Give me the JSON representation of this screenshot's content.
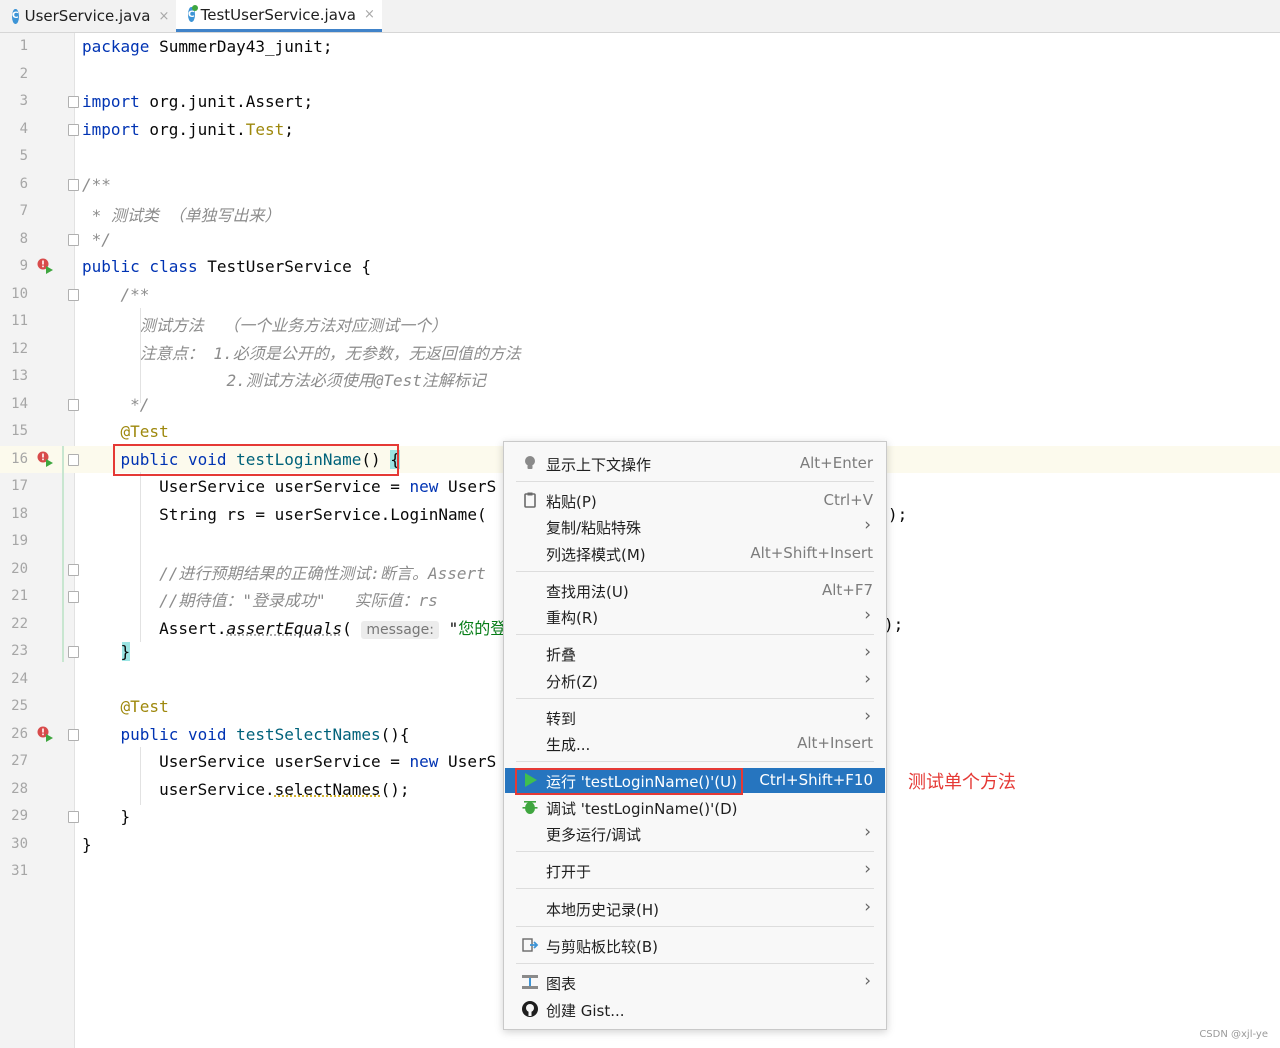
{
  "tabs": [
    {
      "label": "UserService.java",
      "icon": "java-class-icon",
      "close": "×"
    },
    {
      "label": "TestUserService.java",
      "icon": "java-test-class-icon",
      "close": "×"
    }
  ],
  "lines": [
    "1",
    "2",
    "3",
    "4",
    "5",
    "6",
    "7",
    "8",
    "9",
    "10",
    "11",
    "12",
    "13",
    "14",
    "15",
    "16",
    "17",
    "18",
    "19",
    "20",
    "21",
    "22",
    "23",
    "24",
    "25",
    "26",
    "27",
    "28",
    "29",
    "30",
    "31"
  ],
  "code": {
    "l1_kw": "package",
    "l1_rest": " SummerDay43_junit;",
    "l3_kw": "import",
    "l3_rest": " org.junit.Assert;",
    "l4_kw": "import",
    "l4_mid": " org.junit.",
    "l4_test": "Test",
    "l4_end": ";",
    "l6": "/**",
    "l7": " * 测试类 （单独写出来）",
    "l8": " */",
    "l9_kw": "public class",
    "l9_rest": " TestUserService {",
    "l10": "    /**",
    "l11": "      测试方法  （一个业务方法对应测试一个）",
    "l12": "      注意点： 1.必须是公开的，无参数，无返回值的方法",
    "l13": "               2.测试方法必须使用@Test注解标记",
    "l14": "     */",
    "l15": "    @Test",
    "l16_indent": "    ",
    "l16_kw": "public void",
    "l16_fn": " testLoginName",
    "l16_paren": "()",
    "l16_sp": " ",
    "l16_brace": "{",
    "l17_a": "        UserService userService = ",
    "l17_kw": "new",
    "l17_b": " UserS",
    "l17_tail": "",
    "l18_a": "        String rs = userService.LoginName(",
    "l18_tail": ");",
    "l20": "        //进行预期结果的正确性测试:断言。Assert",
    "l21": "        //期待值：\"登录成功\"   实际值：rs",
    "l22_a": "        Assert.",
    "l22_fn": "assertEquals",
    "l22_b": "( ",
    "l22_hint": "message:",
    "l22_c": " \"",
    "l22_str": "您的登",
    "l22_tail": ");",
    "l23": "    }",
    "l25": "    @Test",
    "l26_indent": "    ",
    "l26_kw": "public void",
    "l26_fn": " testSelectNames",
    "l26_rest": "(){",
    "l27_a": "        UserService userService = ",
    "l27_kw": "new",
    "l27_b": " UserS",
    "l28_a": "        userService.",
    "l28_fn": "selectNames",
    "l28_b": "();",
    "l29": "    }",
    "l30": "}"
  },
  "menu": {
    "items": [
      {
        "label": "显示上下文操作",
        "shortcut": "Alt+Enter",
        "icon": "lightbulb-icon"
      },
      {
        "label": "粘贴(P)",
        "shortcut": "Ctrl+V",
        "icon": "clipboard-icon"
      },
      {
        "label": "复制/粘贴特殊",
        "arrow": "›"
      },
      {
        "label": "列选择模式(M)",
        "shortcut": "Alt+Shift+Insert"
      },
      {
        "label": "查找用法(U)",
        "shortcut": "Alt+F7"
      },
      {
        "label": "重构(R)",
        "arrow": "›"
      },
      {
        "label": "折叠",
        "arrow": "›"
      },
      {
        "label": "分析(Z)",
        "arrow": "›"
      },
      {
        "label": "转到",
        "arrow": "›"
      },
      {
        "label": "生成...",
        "shortcut": "Alt+Insert"
      },
      {
        "label": "运行 'testLoginName()'(U)",
        "shortcut": "Ctrl+Shift+F10",
        "icon": "run-icon"
      },
      {
        "label": "调试 'testLoginName()'(D)",
        "icon": "debug-icon"
      },
      {
        "label": "更多运行/调试",
        "arrow": "›"
      },
      {
        "label": "打开于",
        "arrow": "›"
      },
      {
        "label": "本地历史记录(H)",
        "arrow": "›"
      },
      {
        "label": "与剪贴板比较(B)",
        "icon": "compare-icon"
      },
      {
        "label": "图表",
        "arrow": "›",
        "icon": "diagram-icon"
      },
      {
        "label": "创建 Gist...",
        "icon": "github-icon"
      }
    ]
  },
  "annotation": "测试单个方法",
  "watermark": "CSDN @xjl-ye",
  "colors": {
    "keyword": "#0033b3",
    "annotation": "#9e880d",
    "comment": "#8c8c8c",
    "selection": "#2675bf",
    "highlight": "#e53935"
  }
}
